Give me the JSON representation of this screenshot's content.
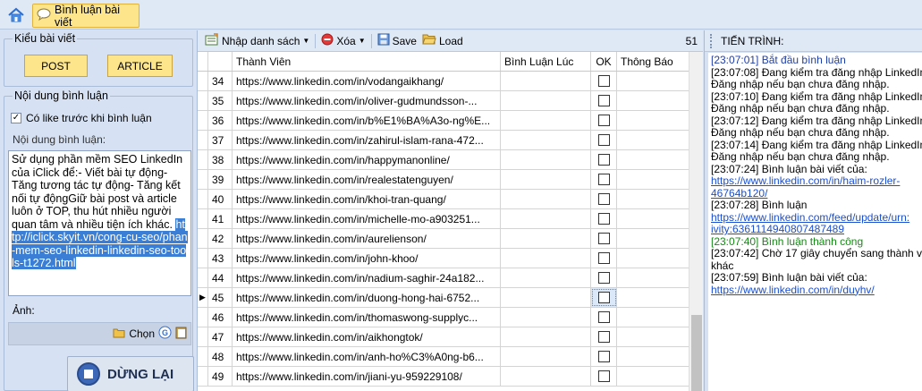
{
  "topbar": {
    "home_icon": "home-icon",
    "tab_label": "Bình luận bài viết"
  },
  "left": {
    "post_type_title": "Kiểu bài viết",
    "post_button": "POST",
    "article_button": "ARTICLE",
    "content_title": "Nội dung bình luận",
    "like_checkbox_label": "Có like trước khi bình luận",
    "like_checked": true,
    "comment_label": "Nội dung bình luận:",
    "comment_text": "Sử dụng phần mềm SEO LinkedIn của iClick để:- Viết bài tự động- Tăng tương tác tự động- Tăng kết nối tự độngGiữ bài post và article luôn ở TOP, thu hút nhiều người quan tâm và nhiều tiện ích khác.",
    "comment_link": "http://iclick.skyit.vn/cong-cu-seo/phan-mem-seo-linkedin-linkedin-seo-tools-t1272.html",
    "image_label": "Ảnh:",
    "choose_label": "Chọn",
    "stop_button": "DỪNG LẠI"
  },
  "toolbar": {
    "import_label": "Nhập danh sách",
    "delete_label": "Xóa",
    "save_label": "Save",
    "load_label": "Load",
    "count": "51"
  },
  "grid": {
    "headers": [
      "Thành Viên",
      "Bình Luận Lúc",
      "OK",
      "Thông Báo"
    ],
    "rows": [
      {
        "num": "34",
        "url": "https://www.linkedin.com/in/vodangaikhang/"
      },
      {
        "num": "35",
        "url": "https://www.linkedin.com/in/oliver-gudmundsson-..."
      },
      {
        "num": "36",
        "url": "https://www.linkedin.com/in/b%E1%BA%A3o-ng%E..."
      },
      {
        "num": "37",
        "url": "https://www.linkedin.com/in/zahirul-islam-rana-472..."
      },
      {
        "num": "38",
        "url": "https://www.linkedin.com/in/happymanonline/"
      },
      {
        "num": "39",
        "url": "https://www.linkedin.com/in/realestatenguyen/"
      },
      {
        "num": "40",
        "url": "https://www.linkedin.com/in/khoi-tran-quang/"
      },
      {
        "num": "41",
        "url": "https://www.linkedin.com/in/michelle-mo-a903251..."
      },
      {
        "num": "42",
        "url": "https://www.linkedin.com/in/aurelienson/"
      },
      {
        "num": "43",
        "url": "https://www.linkedin.com/in/john-khoo/"
      },
      {
        "num": "44",
        "url": "https://www.linkedin.com/in/nadium-saghir-24a182..."
      },
      {
        "num": "45",
        "url": "https://www.linkedin.com/in/duong-hong-hai-6752...",
        "current": true
      },
      {
        "num": "46",
        "url": "https://www.linkedin.com/in/thomaswong-supplyc..."
      },
      {
        "num": "47",
        "url": "https://www.linkedin.com/in/aikhongtok/"
      },
      {
        "num": "48",
        "url": "https://www.linkedin.com/in/anh-ho%C3%A0ng-b6..."
      },
      {
        "num": "49",
        "url": "https://www.linkedin.com/in/jiani-yu-959229108/"
      }
    ]
  },
  "log": {
    "title": "TIẾN TRÌNH:",
    "lines": [
      {
        "text": "[23:07:01]   Bắt đầu bình luận",
        "style": "blue"
      },
      {
        "text": "[23:07:08]   Đang kiểm tra đăng nhập LinkedIn",
        "style": "normal"
      },
      {
        "text": "Đăng nhập nếu bạn chưa đăng nhập.",
        "style": "normal"
      },
      {
        "text": "[23:07:10]   Đang kiểm tra đăng nhập LinkedIn",
        "style": "normal"
      },
      {
        "text": "Đăng nhập nếu bạn chưa đăng nhập.",
        "style": "normal"
      },
      {
        "text": "[23:07:12]   Đang kiểm tra đăng nhập LinkedIn",
        "style": "normal"
      },
      {
        "text": "Đăng nhập nếu bạn chưa đăng nhập.",
        "style": "normal"
      },
      {
        "text": "[23:07:14]   Đang kiểm tra đăng nhập LinkedIn",
        "style": "normal"
      },
      {
        "text": "Đăng nhập nếu bạn chưa đăng nhập.",
        "style": "normal"
      },
      {
        "text": "[23:07:24]      Bình luận bài viết của:",
        "style": "normal"
      },
      {
        "text": "https://www.linkedin.com/in/haim-rozler-",
        "style": "link"
      },
      {
        "text": "46764b120/",
        "style": "link"
      },
      {
        "text": "[23:07:28]      Bình luận",
        "style": "normal"
      },
      {
        "text": "https://www.linkedin.com/feed/update/urn:",
        "style": "link"
      },
      {
        "text": "ivity:6361114940807487489",
        "style": "link"
      },
      {
        "text": "[23:07:40]      Bình luận thành công",
        "style": "green"
      },
      {
        "text": "[23:07:42]   Chờ 17 giây chuyển sang thành v",
        "style": "normal"
      },
      {
        "text": "khác",
        "style": "normal"
      },
      {
        "text": "[23:07:59]      Bình luận bài viết của:",
        "style": "normal"
      },
      {
        "text": "https://www.linkedin.com/in/duyhv/",
        "style": "link"
      }
    ]
  },
  "colors": {
    "accent_yellow": "#fde58c",
    "panel_blue": "#d6e2f3",
    "log_green": "#168a16",
    "log_blue": "#1f3fa8",
    "selection": "#3a7fd5"
  }
}
